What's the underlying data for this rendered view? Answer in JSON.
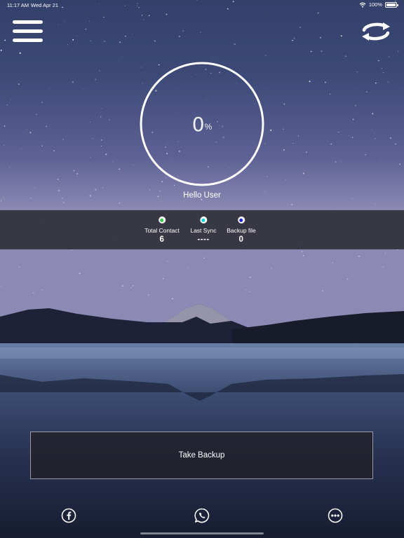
{
  "status_bar": {
    "time": "11:17 AM",
    "date": "Wed Apr 21",
    "battery": "100%"
  },
  "progress": {
    "value": "0",
    "unit": "%"
  },
  "greeting": "Hello User",
  "stats": [
    {
      "label": "Total Contact",
      "value": "6",
      "color": "#2ecc40"
    },
    {
      "label": "Last Sync",
      "value": "----",
      "color": "#00d2d2"
    },
    {
      "label": "Backup file",
      "value": "0",
      "color": "#2424d6"
    }
  ],
  "backup_button": {
    "label": "Take Backup"
  },
  "icons": {
    "menu": "hamburger-menu-icon",
    "sync": "sync-arrows-icon",
    "share": [
      "facebook-icon",
      "whatsapp-icon",
      "more-icon"
    ]
  },
  "colors": {
    "accent_text": "#ffffff",
    "panel": "#2c2c34"
  }
}
